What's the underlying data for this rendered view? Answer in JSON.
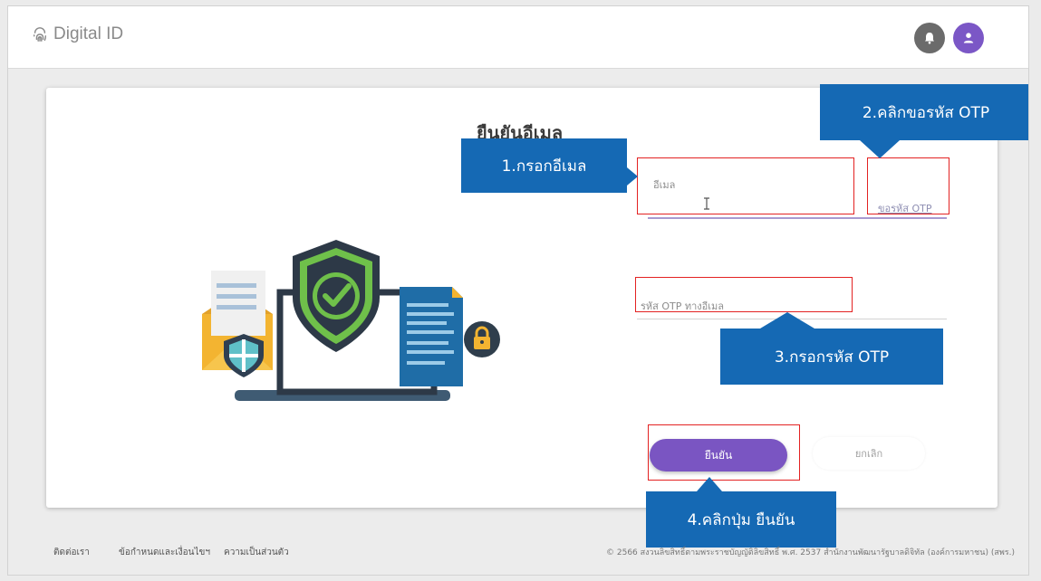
{
  "header": {
    "logo_text": "Digital ID",
    "bell_icon": "bell-icon",
    "profile_icon": "user-icon",
    "accent": "#7b57c6"
  },
  "card": {
    "title": "ยืนยันอีเมล",
    "email_label": "อีเมล",
    "request_otp_link": "ขอรหัส OTP",
    "otp_label": "รหัส OTP ทางอีเมล",
    "confirm_button": "ยืนยัน",
    "cancel_button": "ยกเลิก"
  },
  "callouts": {
    "step1": "1.กรอกอีเมล",
    "step2": "2.คลิกขอรหัส OTP",
    "step3": "3.กรอกรหัส OTP",
    "step4": "4.คลิกปุ่ม ยืนยัน",
    "color": "#1569b4",
    "highlight_color": "#e32222"
  },
  "footer": {
    "links": [
      "ติดต่อเรา",
      "ข้อกำหนดและเงื่อนไขฯ",
      "ความเป็นส่วนตัว"
    ],
    "copyright": "© 2566 สงวนลิขสิทธิ์ตามพระราชบัญญัติลิขสิทธิ์ พ.ศ. 2537 สำนักงานพัฒนารัฐบาลดิจิทัล (องค์การมหาชน) (สพร.)"
  }
}
